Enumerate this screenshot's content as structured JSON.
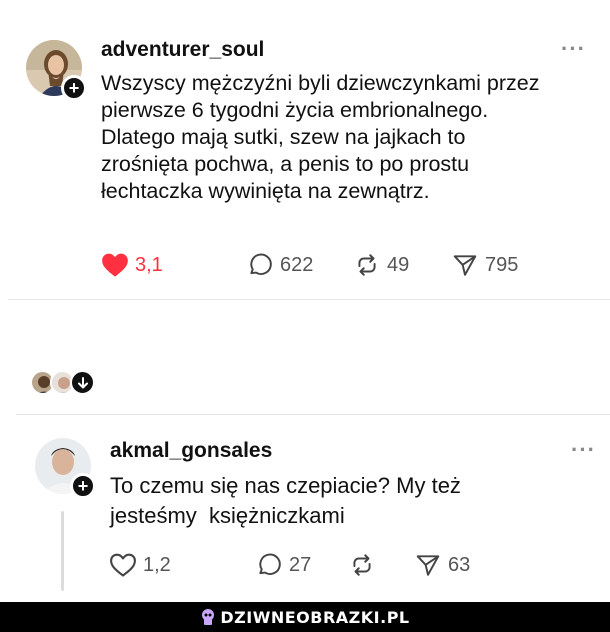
{
  "post1": {
    "username": "adventurer_soul",
    "lines": [
      "Wszyscy mężczyźni byli dziewczynkami przez",
      "pierwsze 6 tygodni życia embrionalnego.",
      "Dlatego mają sutki, szew na jajkach to",
      "zrośnięta pochwa, a penis to po prostu",
      "łechtaczka wywinięta na zewnątrz."
    ],
    "likes": "3,1",
    "comments": "622",
    "reposts": "49",
    "shares": "795",
    "liked": true,
    "accent_color": "#ff3040"
  },
  "post2": {
    "username": "akmal_gonsales",
    "lines": [
      "To czemu się nas czepiacie? My też",
      "jesteśmy  księżniczkami"
    ],
    "likes": "1,2",
    "comments": "27",
    "reposts": "",
    "shares": "63"
  },
  "footer": {
    "site": "DZIWNEOBRAZKI.PL"
  }
}
